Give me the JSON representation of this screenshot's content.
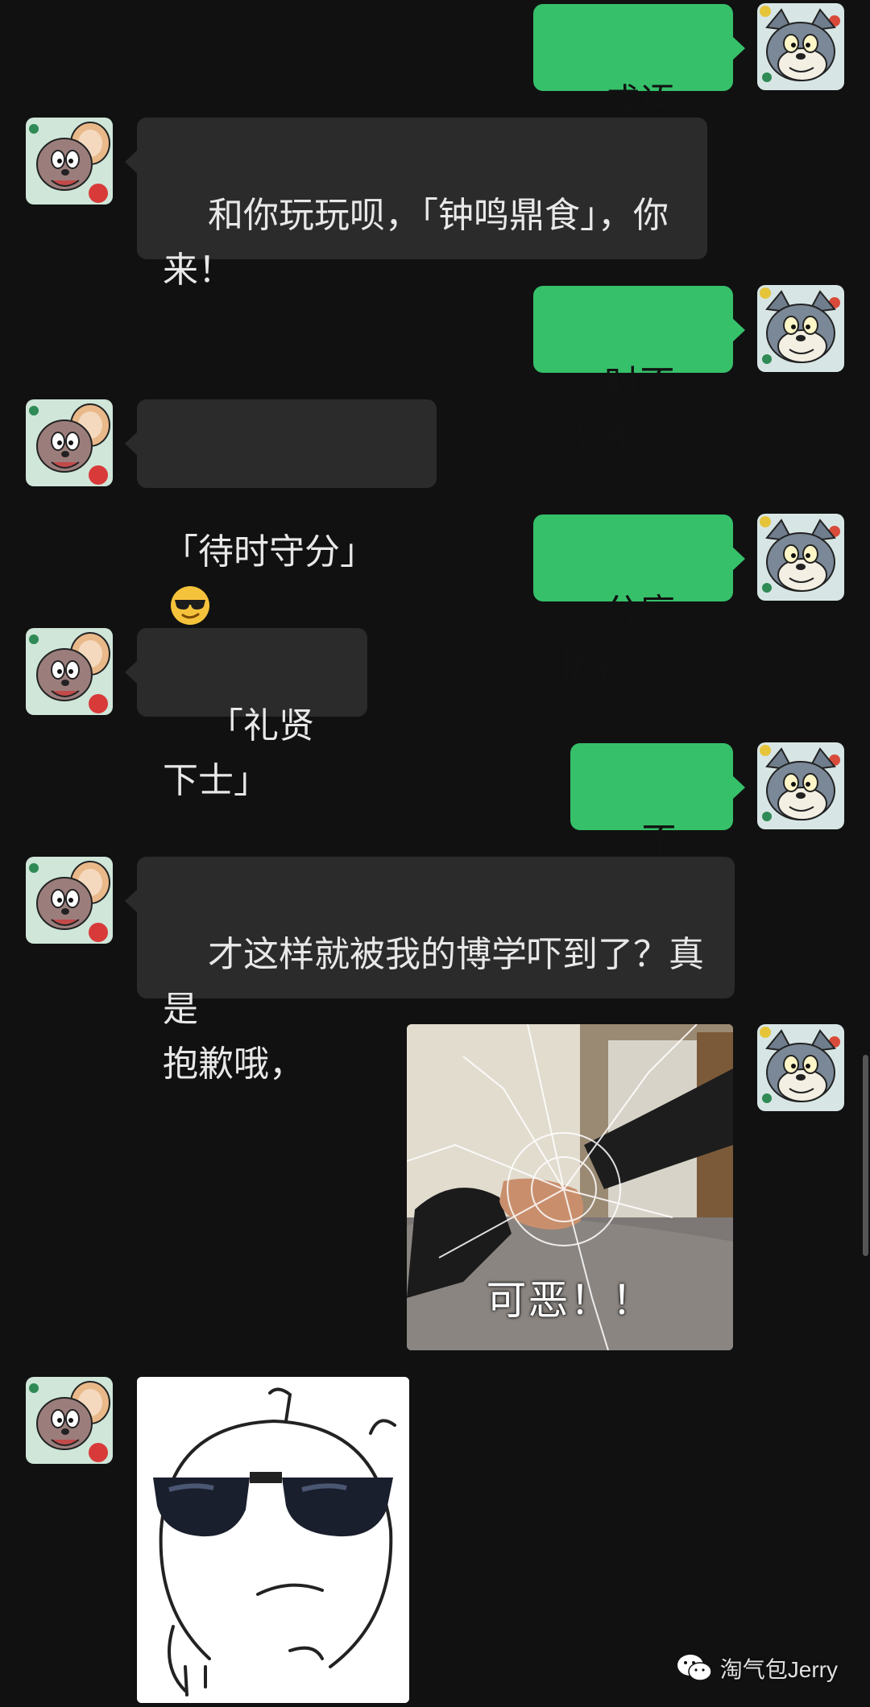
{
  "messages": [
    {
      "side": "out",
      "text": "成语接龙"
    },
    {
      "side": "in",
      "text": "和你玩玩呗，「钟鸣鼎食」，你\n来！"
    },
    {
      "side": "out",
      "text": "时不我待"
    },
    {
      "side": "in",
      "text": "「待时守分」",
      "emoji": "sunglasses-emoji"
    },
    {
      "side": "out",
      "text": "分庭抗礼"
    },
    {
      "side": "in",
      "text": "「礼贤下士」"
    },
    {
      "side": "out",
      "text": "不玩了"
    },
    {
      "side": "in",
      "text": "才这样就被我的博学吓到了？真是\n抱歉哦，"
    },
    {
      "side": "out",
      "sticker": "fist-breaking-glass",
      "caption": "可恶！！"
    },
    {
      "side": "in",
      "sticker": "cartoon-with-sunglasses"
    }
  ],
  "avatars": {
    "out": "tom-cat-avatar",
    "in": "jerry-mouse-avatar"
  },
  "watermark": {
    "icon": "wechat-icon",
    "text": "淘气包Jerry"
  },
  "colors": {
    "background": "#111111",
    "incoming_bubble": "#2b2b2b",
    "outgoing_bubble": "#36c06a"
  }
}
